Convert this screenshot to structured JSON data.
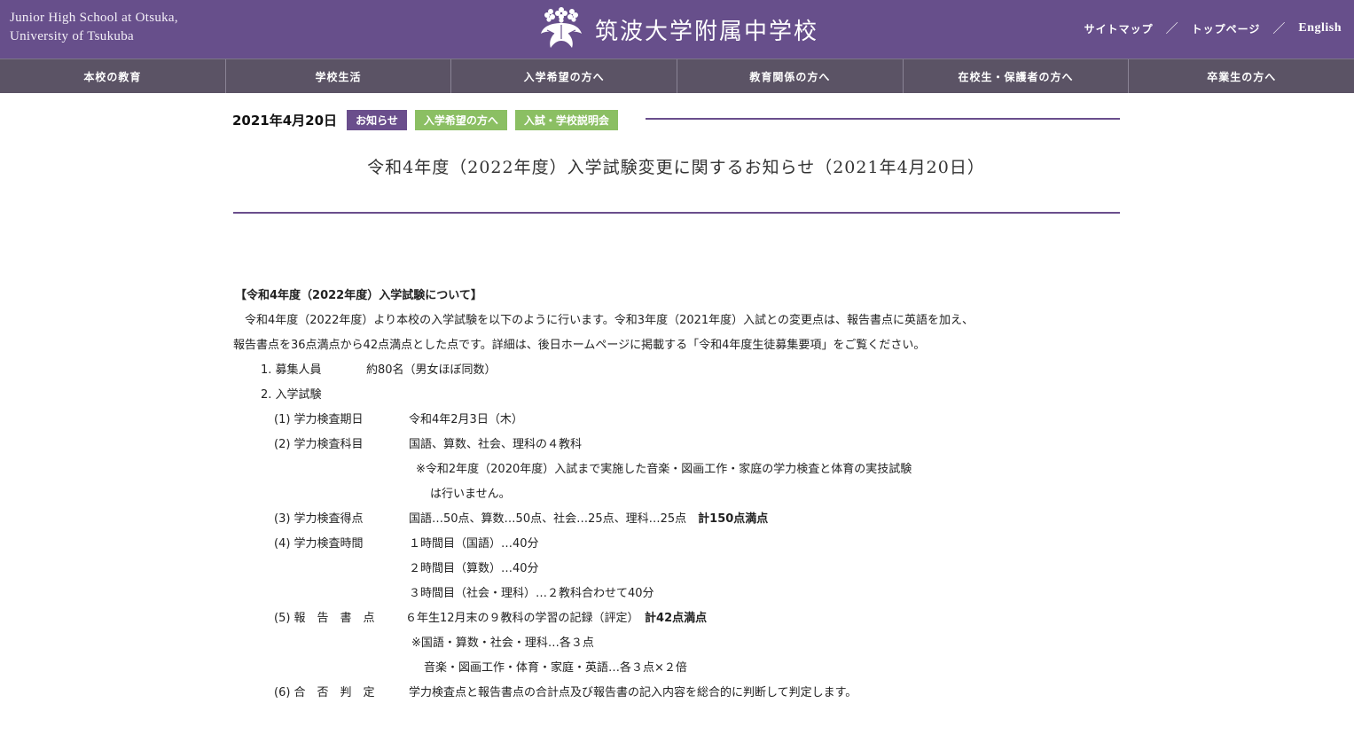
{
  "header": {
    "school_en_line1": "Junior High School at Otsuka,",
    "school_en_line2": "University of Tsukuba",
    "school_jp": "筑波大学附属中学校",
    "crest_icon": "paulownia-crest-icon",
    "util_links": [
      "サイトマップ",
      "トップページ",
      "English"
    ],
    "util_separator": "／"
  },
  "nav": [
    "本校の教育",
    "学校生活",
    "入学希望の方へ",
    "教育関係の方へ",
    "在校生・保護者の方へ",
    "卒業生の方へ"
  ],
  "post": {
    "date": "2021年4月20日",
    "tags": [
      "お知らせ",
      "入学希望の方へ",
      "入試・学校説明会"
    ],
    "title": "令和4年度（2022年度）入学試験変更に関するお知らせ（2021年4月20日）"
  },
  "body": {
    "heading": "【令和4年度（2022年度）入学試験について】",
    "intro1": "　令和4年度（2022年度）より本校の入学試験を以下のように行います。令和3年度（2021年度）入試との変更点は、報告書点に英語を加え、",
    "intro2": "報告書点を36点満点から42点満点とした点です。詳細は、後日ホームページに掲載する「令和4年度生徒募集要項」をご覧ください。",
    "item1_label": "1. 募集人員",
    "item1_value": "約80名（男女ほぼ同数）",
    "item2_label": "2. 入学試験",
    "s1_label": "(1) 学力検査期日",
    "s1_value": "令和4年2月3日（木）",
    "s2_label": "(2) 学力検査科目",
    "s2_value": "国語、算数、社会、理科の４教科",
    "s2_note1": "※令和2年度（2020年度）入試まで実施した音楽・図画工作・家庭の学力検査と体育の実技試験",
    "s2_note2": "は行いません。",
    "s3_label": "(3) 学力検査得点",
    "s3_value": "国語…50点、算数…50点、社会…25点、理科…25点　",
    "s3_total": "計150点満点",
    "s4_label": "(4) 学力検査時間",
    "s4_line1": "１時間目（国語）…40分",
    "s4_line2": "２時間目（算数）…40分",
    "s4_line3": "３時間目（社会・理科）…２教科合わせて40分",
    "s5_label": "(5) 報　告　書　点",
    "s5_value": "６年生12月末の９教科の学習の記録（評定）　",
    "s5_total": "計42点満点",
    "s5_note1": "※国語・算数・社会・理科…各３点",
    "s5_note2": "音楽・図画工作・体育・家庭・英語…各３点×２倍",
    "s6_label": "(6) 合　否　判　定",
    "s6_value": "学力検査点と報告書点の合計点及び報告書の記入内容を総合的に判断して判定します。"
  },
  "colors": {
    "header_bg": "#674f8b",
    "nav_bg": "#5b5365",
    "accent_purple": "#6a4e8c",
    "tag_green": "#8bbf63"
  }
}
